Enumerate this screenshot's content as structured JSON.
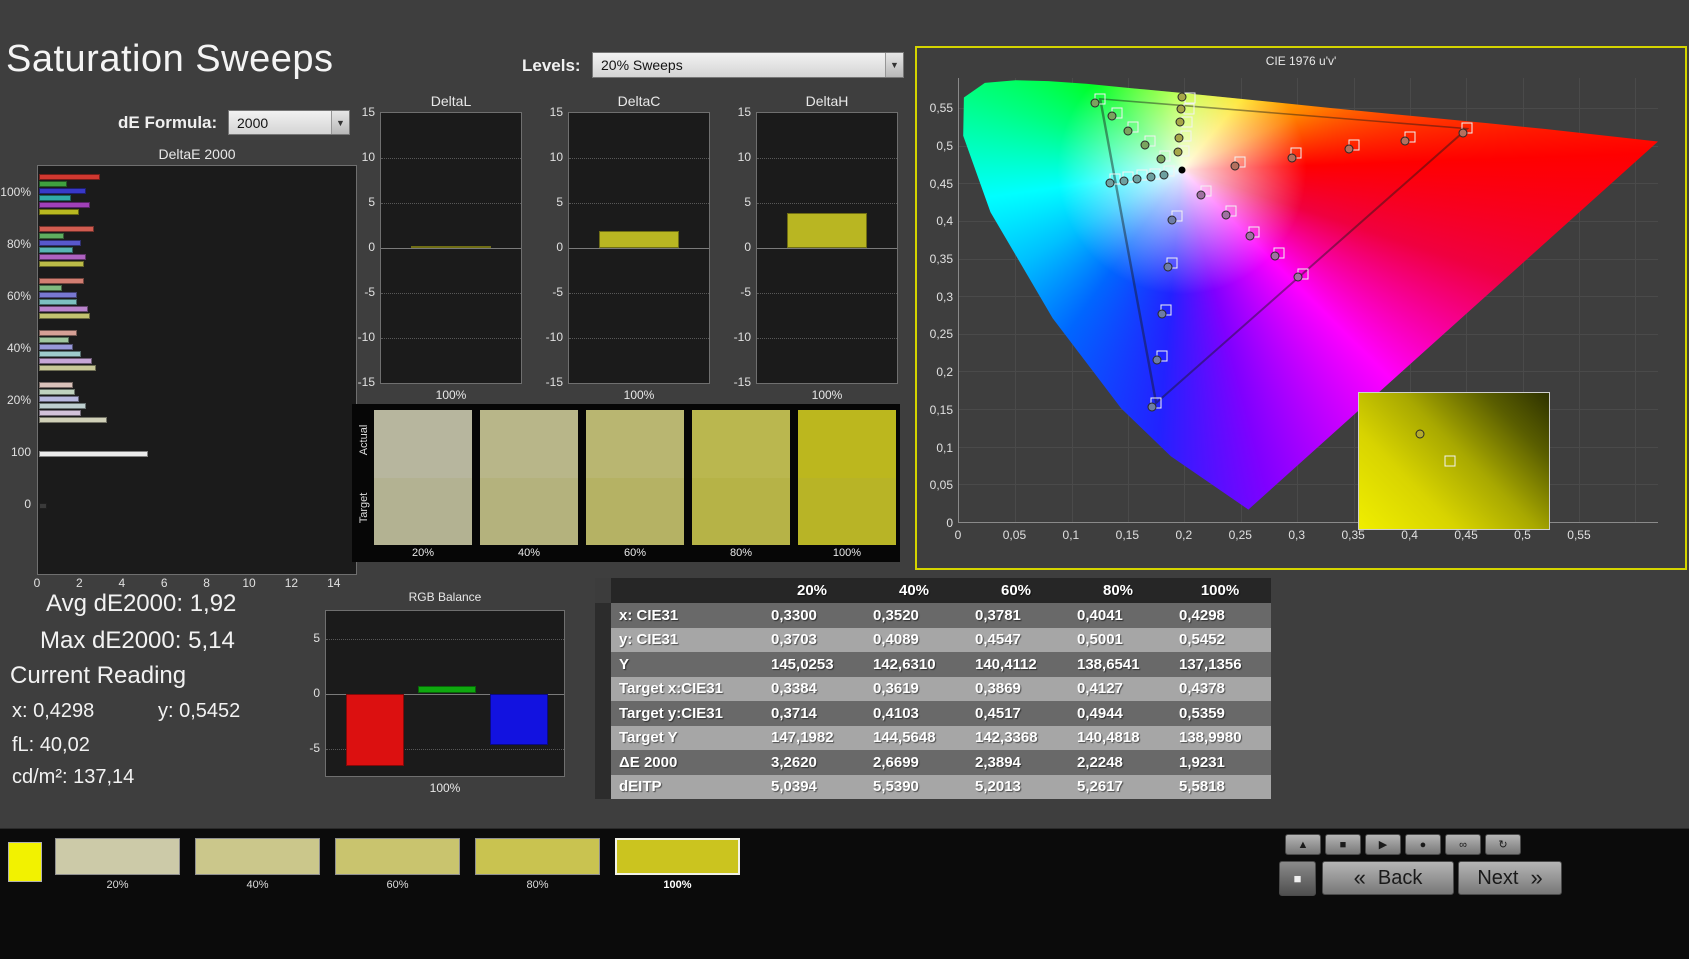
{
  "app": {
    "title": "Saturation Sweeps"
  },
  "controls": {
    "levels_label": "Levels:",
    "levels_value": "20% Sweeps",
    "de_formula_label": "dE Formula:",
    "de_formula_value": "2000"
  },
  "de_chart": {
    "title": "DeltaE 2000",
    "x_ticks": [
      "0",
      "2",
      "4",
      "6",
      "8",
      "10",
      "12",
      "14"
    ],
    "x_max": 15,
    "groups": [
      {
        "label": "100%",
        "bars": [
          {
            "c": "#d03830",
            "v": 2.9
          },
          {
            "c": "#3fa03f",
            "v": 1.3
          },
          {
            "c": "#3838c8",
            "v": 2.2
          },
          {
            "c": "#30a8a8",
            "v": 1.5
          },
          {
            "c": "#a040b8",
            "v": 2.4
          },
          {
            "c": "#b8b820",
            "v": 1.9
          }
        ]
      },
      {
        "label": "80%",
        "bars": [
          {
            "c": "#d05c50",
            "v": 2.6
          },
          {
            "c": "#5fae5f",
            "v": 1.2
          },
          {
            "c": "#5858cc",
            "v": 2.0
          },
          {
            "c": "#58b4b4",
            "v": 1.6
          },
          {
            "c": "#ae62c0",
            "v": 2.2
          },
          {
            "c": "#bcbc48",
            "v": 2.1
          }
        ]
      },
      {
        "label": "60%",
        "bars": [
          {
            "c": "#d27e72",
            "v": 2.1
          },
          {
            "c": "#7fba7f",
            "v": 1.1
          },
          {
            "c": "#7878d2",
            "v": 1.8
          },
          {
            "c": "#7cc0c0",
            "v": 1.8
          },
          {
            "c": "#ba84cc",
            "v": 2.3
          },
          {
            "c": "#c2c270",
            "v": 2.4
          }
        ]
      },
      {
        "label": "40%",
        "bars": [
          {
            "c": "#d6a096",
            "v": 1.8
          },
          {
            "c": "#9fc69f",
            "v": 1.4
          },
          {
            "c": "#9898d8",
            "v": 1.6
          },
          {
            "c": "#9ecccc",
            "v": 2.0
          },
          {
            "c": "#c6a6d6",
            "v": 2.5
          },
          {
            "c": "#c8c898",
            "v": 2.7
          }
        ]
      },
      {
        "label": "20%",
        "bars": [
          {
            "c": "#dac2ba",
            "v": 1.6
          },
          {
            "c": "#bfd2bf",
            "v": 1.7
          },
          {
            "c": "#b8b8de",
            "v": 1.9
          },
          {
            "c": "#becfcf",
            "v": 2.2
          },
          {
            "c": "#d2c2da",
            "v": 2.0
          },
          {
            "c": "#d0d0b8",
            "v": 3.2
          }
        ]
      },
      {
        "label": "100",
        "bars": [
          {
            "c": "#ececec",
            "v": 5.14
          }
        ]
      },
      {
        "label": "0",
        "bars": [
          {
            "c": "#3a3a3a",
            "v": 0.4
          }
        ]
      }
    ]
  },
  "delta_axis": {
    "ticks": [
      "15",
      "10",
      "5",
      "0",
      "-5",
      "-10",
      "-15"
    ],
    "max": 15,
    "x_label": "100%",
    "bar_color": "#b9b622"
  },
  "delta_charts": [
    {
      "title": "DeltaL",
      "value": 0.1
    },
    {
      "title": "DeltaC",
      "value": 1.9
    },
    {
      "title": "DeltaH",
      "value": 3.9
    }
  ],
  "swatch_panel": {
    "row_labels": [
      "Actual",
      "Target"
    ],
    "columns": [
      {
        "label": "20%",
        "actual": "#b7b69e",
        "target": "#b3b292"
      },
      {
        "label": "40%",
        "actual": "#b8b689",
        "target": "#b4b27d"
      },
      {
        "label": "60%",
        "actual": "#b9b671",
        "target": "#b5b264"
      },
      {
        "label": "80%",
        "actual": "#bab74f",
        "target": "#b6b347"
      },
      {
        "label": "100%",
        "actual": "#bcb71e",
        "target": "#b8b426"
      }
    ]
  },
  "cie": {
    "title": "CIE 1976 u'v'",
    "x_ticks": [
      "0",
      "0,05",
      "0,1",
      "0,15",
      "0,2",
      "0,25",
      "0,3",
      "0,35",
      "0,4",
      "0,45",
      "0,5",
      "0,55"
    ],
    "y_ticks": [
      "0,55",
      "0,5",
      "0,45",
      "0,4",
      "0,35",
      "0,3",
      "0,25",
      "0,2",
      "0,15",
      "0,1",
      "0,05",
      "0"
    ],
    "white_point": {
      "u": 0.198,
      "v": 0.468
    },
    "targets": [
      {
        "u": 0.249,
        "v": 0.479
      },
      {
        "u": 0.299,
        "v": 0.49
      },
      {
        "u": 0.35,
        "v": 0.501
      },
      {
        "u": 0.4,
        "v": 0.512
      },
      {
        "u": 0.451,
        "v": 0.523
      },
      {
        "u": 0.183,
        "v": 0.487
      },
      {
        "u": 0.169,
        "v": 0.506
      },
      {
        "u": 0.154,
        "v": 0.525
      },
      {
        "u": 0.14,
        "v": 0.544
      },
      {
        "u": 0.125,
        "v": 0.562
      },
      {
        "u": 0.193,
        "v": 0.406
      },
      {
        "u": 0.189,
        "v": 0.344
      },
      {
        "u": 0.184,
        "v": 0.282
      },
      {
        "u": 0.18,
        "v": 0.22
      },
      {
        "u": 0.175,
        "v": 0.158
      },
      {
        "u": 0.186,
        "v": 0.466
      },
      {
        "u": 0.174,
        "v": 0.463
      },
      {
        "u": 0.162,
        "v": 0.461
      },
      {
        "u": 0.15,
        "v": 0.458
      },
      {
        "u": 0.138,
        "v": 0.456
      },
      {
        "u": 0.219,
        "v": 0.44
      },
      {
        "u": 0.241,
        "v": 0.413
      },
      {
        "u": 0.262,
        "v": 0.385
      },
      {
        "u": 0.284,
        "v": 0.358
      },
      {
        "u": 0.305,
        "v": 0.33
      },
      {
        "u": 0.2,
        "v": 0.493
      },
      {
        "u": 0.201,
        "v": 0.513
      },
      {
        "u": 0.202,
        "v": 0.532
      },
      {
        "u": 0.204,
        "v": 0.549
      },
      {
        "u": 0.205,
        "v": 0.564
      }
    ],
    "measured": [
      {
        "u": 0.245,
        "v": 0.473,
        "c": "#b4705e"
      },
      {
        "u": 0.295,
        "v": 0.484,
        "c": "#b4705e"
      },
      {
        "u": 0.346,
        "v": 0.495,
        "c": "#b4705e"
      },
      {
        "u": 0.396,
        "v": 0.506,
        "c": "#b4705e"
      },
      {
        "u": 0.447,
        "v": 0.517,
        "c": "#b4705e"
      },
      {
        "u": 0.179,
        "v": 0.482,
        "c": "#7aa45e"
      },
      {
        "u": 0.165,
        "v": 0.501,
        "c": "#7aa45e"
      },
      {
        "u": 0.15,
        "v": 0.52,
        "c": "#7aa45e"
      },
      {
        "u": 0.136,
        "v": 0.539,
        "c": "#7aa45e"
      },
      {
        "u": 0.121,
        "v": 0.557,
        "c": "#7aa45e"
      },
      {
        "u": 0.189,
        "v": 0.401,
        "c": "#6e7ca6"
      },
      {
        "u": 0.185,
        "v": 0.339,
        "c": "#6e7ca6"
      },
      {
        "u": 0.18,
        "v": 0.277,
        "c": "#6e7ca6"
      },
      {
        "u": 0.176,
        "v": 0.215,
        "c": "#6e7ca6"
      },
      {
        "u": 0.171,
        "v": 0.153,
        "c": "#6e7ca6"
      },
      {
        "u": 0.182,
        "v": 0.461,
        "c": "#6ea0a0"
      },
      {
        "u": 0.17,
        "v": 0.458,
        "c": "#6ea0a0"
      },
      {
        "u": 0.158,
        "v": 0.456,
        "c": "#6ea0a0"
      },
      {
        "u": 0.146,
        "v": 0.453,
        "c": "#6ea0a0"
      },
      {
        "u": 0.134,
        "v": 0.451,
        "c": "#6ea0a0"
      },
      {
        "u": 0.215,
        "v": 0.435,
        "c": "#a070a2"
      },
      {
        "u": 0.237,
        "v": 0.408,
        "c": "#a070a2"
      },
      {
        "u": 0.258,
        "v": 0.38,
        "c": "#a070a2"
      },
      {
        "u": 0.28,
        "v": 0.353,
        "c": "#a070a2"
      },
      {
        "u": 0.301,
        "v": 0.325,
        "c": "#a070a2"
      },
      {
        "u": 0.1946,
        "v": 0.4913,
        "c": "#a6a648"
      },
      {
        "u": 0.1955,
        "v": 0.5109,
        "c": "#a6a648"
      },
      {
        "u": 0.1964,
        "v": 0.5314,
        "c": "#a6a648"
      },
      {
        "u": 0.1973,
        "v": 0.5493,
        "c": "#a6a648"
      },
      {
        "u": 0.198,
        "v": 0.5651,
        "c": "#a6a648"
      }
    ]
  },
  "stats": {
    "avg_label": "Avg dE2000:",
    "avg_value": "1,92",
    "max_label": "Max dE2000:",
    "max_value": "5,14",
    "current_label": "Current Reading",
    "x_label": "x:",
    "x_value": "0,4298",
    "y_label": "y:",
    "y_value": "0,5452",
    "fl_label": "fL:",
    "fl_value": "40,02",
    "cd_label": "cd/m²:",
    "cd_value": "137,14"
  },
  "rgb_balance": {
    "title": "RGB Balance",
    "ticks": [
      "5",
      "0",
      "-5"
    ],
    "max": 7.5,
    "x_label": "100%",
    "bars": [
      {
        "c": "#dc1010",
        "v": -6.6
      },
      {
        "c": "#0fa80f",
        "v": 0.7
      },
      {
        "c": "#1212e0",
        "v": -4.7
      }
    ]
  },
  "table": {
    "headers": [
      "20%",
      "40%",
      "60%",
      "80%",
      "100%"
    ],
    "rows": [
      {
        "label": "x: CIE31",
        "values": [
          "0,3300",
          "0,3520",
          "0,3781",
          "0,4041",
          "0,4298"
        ]
      },
      {
        "label": "y: CIE31",
        "values": [
          "0,3703",
          "0,4089",
          "0,4547",
          "0,5001",
          "0,5452"
        ]
      },
      {
        "label": "Y",
        "values": [
          "145,0253",
          "142,6310",
          "140,4112",
          "138,6541",
          "137,1356"
        ]
      },
      {
        "label": "Target x:CIE31",
        "values": [
          "0,3384",
          "0,3619",
          "0,3869",
          "0,4127",
          "0,4378"
        ]
      },
      {
        "label": "Target y:CIE31",
        "values": [
          "0,3714",
          "0,4103",
          "0,4517",
          "0,4944",
          "0,5359"
        ]
      },
      {
        "label": "Target Y",
        "values": [
          "147,1982",
          "144,5648",
          "142,3368",
          "140,4818",
          "138,9980"
        ]
      },
      {
        "label": "ΔE 2000",
        "values": [
          "3,2620",
          "2,6699",
          "2,3894",
          "2,2248",
          "1,9231"
        ]
      },
      {
        "label": "dEITP",
        "values": [
          "5,0394",
          "5,5390",
          "5,2013",
          "5,2617",
          "5,5818"
        ]
      }
    ]
  },
  "bottom_bar": {
    "mini_swatch": "#f2f200",
    "swatches": [
      {
        "label": "20%",
        "c": "#cccaa8"
      },
      {
        "label": "40%",
        "c": "#cbc78b"
      },
      {
        "label": "60%",
        "c": "#c9c46e"
      },
      {
        "label": "80%",
        "c": "#c9c350"
      },
      {
        "label": "100%",
        "c": "#cbc41f",
        "selected": true
      }
    ],
    "transport": [
      {
        "name": "up",
        "glyph": "▲"
      },
      {
        "name": "stop",
        "glyph": "■"
      },
      {
        "name": "play",
        "glyph": "▶"
      },
      {
        "name": "record",
        "glyph": "●"
      },
      {
        "name": "loop",
        "glyph": "∞"
      },
      {
        "name": "refresh",
        "glyph": "↻"
      }
    ],
    "stop_glyph": "■",
    "back": {
      "icon": "«",
      "label": "Back"
    },
    "next": {
      "icon": "»",
      "label": "Next"
    }
  }
}
